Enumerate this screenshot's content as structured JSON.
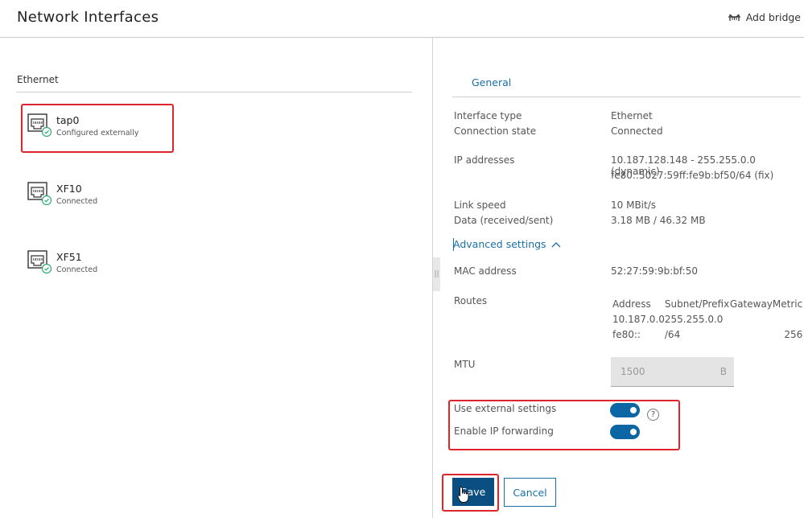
{
  "header": {
    "title": "Network Interfaces",
    "add_bridge_label": "Add bridge"
  },
  "left": {
    "section_title": "Ethernet",
    "interfaces": [
      {
        "name": "tap0",
        "status": "Configured externally"
      },
      {
        "name": "XF10",
        "status": "Connected"
      },
      {
        "name": "XF51",
        "status": "Connected"
      }
    ]
  },
  "details": {
    "tab_general": "General",
    "interface_type_label": "Interface type",
    "interface_type_value": "Ethernet",
    "connection_state_label": "Connection state",
    "connection_state_value": "Connected",
    "ip_addresses_label": "IP addresses",
    "ip_addresses": [
      "10.187.128.148 - 255.255.0.0 (dynamic)",
      "fe80::5027:59ff:fe9b:bf50/64 (fix)"
    ],
    "link_speed_label": "Link speed",
    "link_speed_value": "10 MBit/s",
    "data_label": "Data (received/sent)",
    "data_value": "3.18 MB / 46.32 MB",
    "advanced_settings_label": "Advanced settings",
    "mac_address_label": "MAC address",
    "mac_address_value": "52:27:59:9b:bf:50",
    "routes_label": "Routes",
    "routes": {
      "headers": [
        "Address",
        "Subnet/Prefix",
        "Gateway",
        "Metric"
      ],
      "rows": [
        [
          "10.187.0.0",
          "255.255.0.0",
          "",
          ""
        ],
        [
          "fe80::",
          "/64",
          "",
          "256"
        ]
      ]
    },
    "mtu_label": "MTU",
    "mtu_value": "1500",
    "mtu_unit": "B",
    "use_external_label": "Use external settings",
    "use_external_on": true,
    "ip_forwarding_label": "Enable IP forwarding",
    "ip_forwarding_on": true,
    "help_glyph": "?"
  },
  "actions": {
    "save_label": "Save",
    "cancel_label": "Cancel"
  },
  "colors": {
    "accent": "#1a6fa8",
    "toggle_on": "#0b66a3",
    "save_button": "#0b4f82",
    "status_ok": "#2eaa6f",
    "highlight": "#e0242b"
  }
}
